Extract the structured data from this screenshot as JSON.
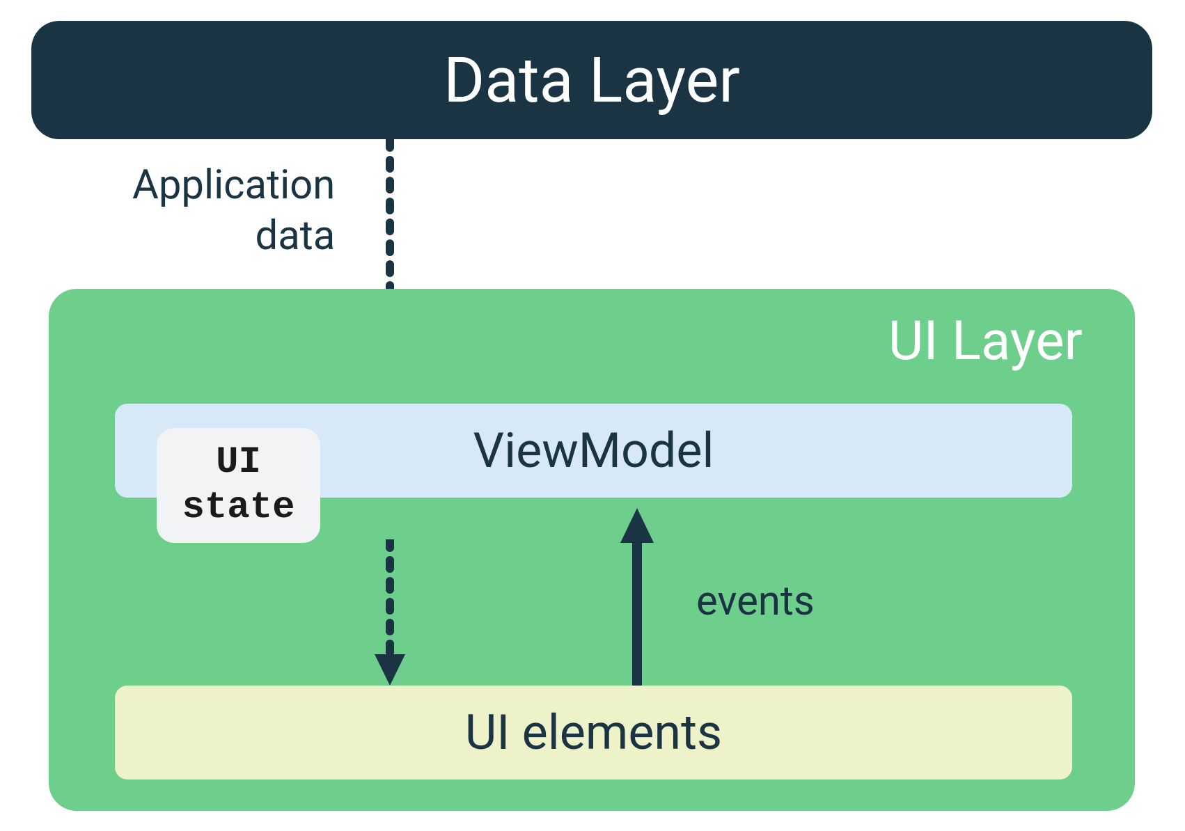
{
  "dataLayer": {
    "label": "Data Layer"
  },
  "arrows": {
    "applicationData": {
      "label": "Application\ndata"
    },
    "events": {
      "label": "events"
    }
  },
  "uiLayer": {
    "label": "UI Layer",
    "viewModel": {
      "label": "ViewModel"
    },
    "uiState": {
      "label": "UI\nstate"
    },
    "uiElements": {
      "label": "UI elements"
    }
  },
  "colors": {
    "darkBlue": "#1a3444",
    "green": "#6dcf8b",
    "lightBlue": "#d7e9f7",
    "lightYellow": "#eef2c8",
    "lightGray": "#f1f3f4"
  }
}
